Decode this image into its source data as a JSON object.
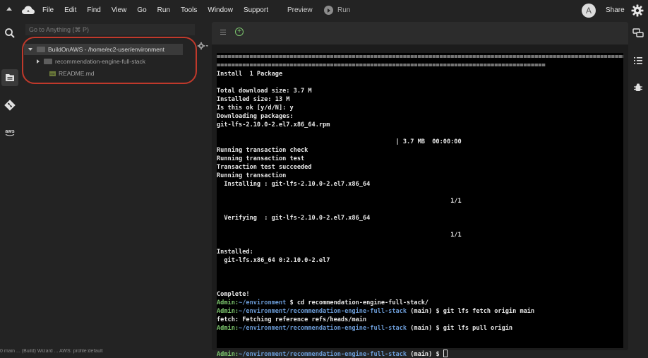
{
  "menubar": {
    "items": [
      "File",
      "Edit",
      "Find",
      "View",
      "Go",
      "Run",
      "Tools",
      "Window",
      "Support"
    ],
    "preview": "Preview",
    "run": "Run",
    "avatar_letter": "A",
    "share": "Share"
  },
  "sidebar": {
    "goto_placeholder": "Go to Anything (⌘ P)",
    "tree": {
      "root": "BuildOnAWS - /home/ec2-user/environment",
      "folder": "recommendation-engine-full-stack",
      "file": "README.md",
      "file_badge": "MD"
    }
  },
  "statusbar": {
    "text": "0 main  ...  (Build) Wizard  ...  AWS: profile:default"
  },
  "left_icons": [
    "search-icon",
    "files-icon",
    "git-icon",
    "aws-icon"
  ],
  "right_icons": [
    "collaborate-icon",
    "outline-icon",
    "debugger-icon"
  ],
  "colors": {
    "accent_green": "#7ec86f",
    "path_blue": "#6b9bd6",
    "highlight_red": "#c0392b"
  },
  "terminal": {
    "lines": [
      {
        "text": "================================================================================================================="
      },
      {
        "text": "=========================================================================================="
      },
      {
        "text": "Install  1 Package"
      },
      {
        "text": ""
      },
      {
        "text": "Total download size: 3.7 M"
      },
      {
        "text": "Installed size: 13 M"
      },
      {
        "text": "Is this ok [y/d/N]: y"
      },
      {
        "text": "Downloading packages:"
      },
      {
        "text": "git-lfs-2.10.0-2.el7.x86_64.rpm"
      },
      {
        "text": ""
      },
      {
        "text": "                                                 | 3.7 MB  00:00:00"
      },
      {
        "text": "Running transaction check"
      },
      {
        "text": "Running transaction test"
      },
      {
        "text": "Transaction test succeeded"
      },
      {
        "text": "Running transaction"
      },
      {
        "text": "  Installing : git-lfs-2.10.0-2.el7.x86_64"
      },
      {
        "text": ""
      },
      {
        "text": "                                                                1/1"
      },
      {
        "text": ""
      },
      {
        "text": "  Verifying  : git-lfs-2.10.0-2.el7.x86_64"
      },
      {
        "text": ""
      },
      {
        "text": "                                                                1/1"
      },
      {
        "text": ""
      },
      {
        "text": "Installed:"
      },
      {
        "text": "  git-lfs.x86_64 0:2.10.0-2.el7"
      },
      {
        "text": ""
      },
      {
        "text": ""
      },
      {
        "text": ""
      },
      {
        "text": "Complete!"
      },
      {
        "user": "Admin",
        "path": "~/environment",
        "branch": "",
        "cmd": " $ cd recommendation-engine-full-stack/"
      },
      {
        "user": "Admin",
        "path": "~/environment/recommendation-engine-full-stack",
        "branch": " (main)",
        "cmd": " $ git lfs fetch origin main"
      },
      {
        "text": "fetch: Fetching reference refs/heads/main"
      },
      {
        "user": "Admin",
        "path": "~/environment/recommendation-engine-full-stack",
        "branch": " (main)",
        "cmd": " $ git lfs pull origin"
      },
      {
        "text": ""
      },
      {
        "text": ""
      },
      {
        "user": "Admin",
        "path": "~/environment/recommendation-engine-full-stack",
        "branch": " (main)",
        "cmd": " $ ",
        "cursor": true
      }
    ]
  }
}
